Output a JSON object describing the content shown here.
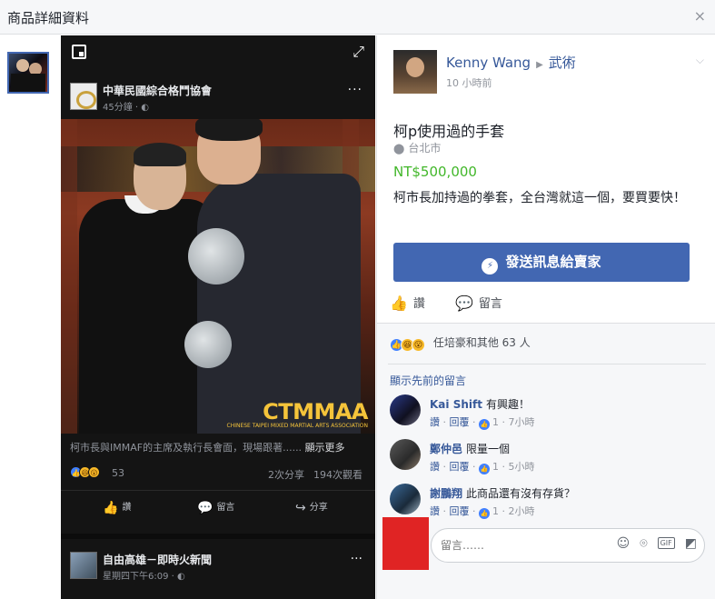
{
  "dialog": {
    "title": "商品詳細資料",
    "close": "×"
  },
  "viewer": {
    "post": {
      "page_name": "中華民國綜合格鬥協會",
      "time": "45分鐘 · ◐",
      "more": "···",
      "watermark": "CTMMAA",
      "watermark_sub": "CHINESE TAIPEI MIXED MARTIAL ARTS ASSOCIATION",
      "caption": "柯市長與IMMAF的主席及執行長會面，現場跟著......",
      "caption_more": "顯示更多",
      "reaction_count": "53",
      "shares": "2次分享",
      "views": "194次觀看",
      "actions": {
        "like": "讚",
        "comment": "留言",
        "share": "分享"
      }
    },
    "next_post": {
      "name": "自由高雄－即時火新聞",
      "time": "星期四下午6:09 · ◐",
      "more": "···"
    }
  },
  "listing": {
    "seller": {
      "name": "Kenny Wang",
      "category": "武術",
      "time": "10 小時前"
    },
    "title": "柯p使用過的手套",
    "location": "台北市",
    "price": "NT$500,000",
    "description": "柯市長加持過的拳套，全台灣就這一個，要買要快！",
    "message_button": "發送訊息給賣家",
    "like": "讚",
    "comment": "留言",
    "likes_summary": "任培豪和其他 63 人",
    "show_previous": "顯示先前的留言",
    "comments": [
      {
        "name": "Kai Shift",
        "text": "有興趣！",
        "like": "讚",
        "reply": "回覆",
        "likes": "1",
        "time": "7小時"
      },
      {
        "name": "鄭仲邑",
        "text": "限量一個",
        "like": "讚",
        "reply": "回覆",
        "likes": "1",
        "time": "5小時"
      },
      {
        "name": "謝鵬翔",
        "text": "此商品還有沒有存貨？",
        "like": "讚",
        "reply": "回覆",
        "likes": "1",
        "time": "2小時"
      }
    ],
    "composer": {
      "placeholder": "留言……"
    }
  },
  "colors": {
    "accent": "#4267b2",
    "price": "#42b72a",
    "link": "#365899",
    "redacted": "#e02424"
  },
  "icons": [
    "close-icon",
    "minimize-icon",
    "expand-icon",
    "globe-icon",
    "like-icon",
    "comment-icon",
    "share-icon",
    "messenger-icon",
    "location-pin-icon",
    "emoji-icon",
    "camera-icon",
    "gif-icon",
    "sticker-icon"
  ]
}
